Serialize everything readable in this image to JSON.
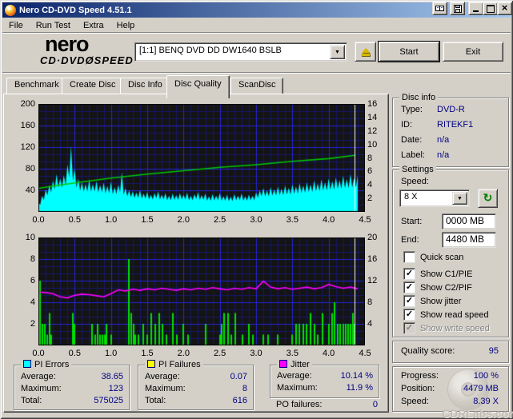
{
  "window": {
    "title": "Nero CD-DVD Speed 4.51.1"
  },
  "titlebar_buttons": {
    "minimize": "_",
    "maximize": "",
    "close": "×"
  },
  "menu": {
    "items": [
      "File",
      "Run Test",
      "Extra",
      "Help"
    ]
  },
  "logo": {
    "line1": "nero",
    "line2": "CD·DVDØSPEED"
  },
  "header": {
    "drive": "[1:1]  BENQ DVD DD DW1640 BSLB",
    "start_label": "Start",
    "exit_label": "Exit"
  },
  "tabs": {
    "items": [
      "Benchmark",
      "Create Disc",
      "Disc Info",
      "Disc Quality",
      "ScanDisc"
    ],
    "active": "Disc Quality"
  },
  "disc_info": {
    "title": "Disc info",
    "rows": [
      {
        "label": "Type:",
        "value": "DVD-R"
      },
      {
        "label": "ID:",
        "value": "RITEKF1"
      },
      {
        "label": "Date:",
        "value": "n/a"
      },
      {
        "label": "Label:",
        "value": "n/a"
      }
    ]
  },
  "settings": {
    "title": "Settings",
    "speed_label": "Speed:",
    "speed_value": "8 X",
    "start_label": "Start:",
    "start_value": "0000 MB",
    "end_label": "End:",
    "end_value": "4480 MB",
    "checkboxes": [
      {
        "label": "Quick scan",
        "checked": false,
        "disabled": false
      },
      {
        "label": "Show C1/PIE",
        "checked": true,
        "disabled": false
      },
      {
        "label": "Show C2/PIF",
        "checked": true,
        "disabled": false
      },
      {
        "label": "Show jitter",
        "checked": true,
        "disabled": false
      },
      {
        "label": "Show read speed",
        "checked": true,
        "disabled": false
      },
      {
        "label": "Show write speed",
        "checked": true,
        "disabled": true
      }
    ]
  },
  "quality": {
    "label": "Quality score:",
    "value": "95"
  },
  "progress": {
    "rows": [
      {
        "label": "Progress:",
        "value": "100 %"
      },
      {
        "label": "Position:",
        "value": "4479 MB"
      },
      {
        "label": "Speed:",
        "value": "8.39 X"
      }
    ]
  },
  "stats": {
    "pi_errors": {
      "title": "PI Errors",
      "color": "#00ffff",
      "rows": [
        {
          "label": "Average:",
          "value": "38.65"
        },
        {
          "label": "Maximum:",
          "value": "123"
        },
        {
          "label": "Total:",
          "value": "575025"
        }
      ]
    },
    "pi_failures": {
      "title": "PI Failures",
      "color": "#ffff00",
      "rows": [
        {
          "label": "Average:",
          "value": "0.07"
        },
        {
          "label": "Maximum:",
          "value": "8"
        },
        {
          "label": "Total:",
          "value": "616"
        }
      ]
    },
    "jitter": {
      "title": "Jitter",
      "color": "#ff00ff",
      "rows": [
        {
          "label": "Average:",
          "value": "10.14 %"
        },
        {
          "label": "Maximum:",
          "value": "11.9 %"
        }
      ]
    },
    "po_failures": {
      "label": "PO failures:",
      "value": "0"
    }
  },
  "watermark": "CDRLabs.com",
  "colors": {
    "pie_area": "#00ffff",
    "read_speed": "#00c800",
    "pif_bars": "#00e000",
    "jitter_line": "#ff00ff",
    "grid_major": "#2525d8",
    "grid_minor": "#17176a",
    "chart_bg": "#141414",
    "position_marker": "#ffffff",
    "value_text": "#000080"
  },
  "chart_data": [
    {
      "type": "area",
      "title": "PI Errors (C1/PIE) with read-speed overlay",
      "x_unit": "GB",
      "x_range": [
        0,
        4.5
      ],
      "x_ticks": [
        "0.0",
        "0.5",
        "1.0",
        "1.5",
        "2.0",
        "2.5",
        "3.0",
        "3.5",
        "4.0",
        "4.5"
      ],
      "left_axis": {
        "range": [
          0,
          200
        ],
        "ticks": [
          200,
          160,
          120,
          80,
          40
        ]
      },
      "right_axis": {
        "range": [
          0,
          16
        ],
        "ticks": [
          16,
          14,
          12,
          10,
          8,
          6,
          4,
          2
        ]
      },
      "position_marker_x": 4.36,
      "series": [
        {
          "name": "PI Errors",
          "render": "area",
          "axis": "left",
          "color": "#00ffff",
          "x_start": 0,
          "x_step": 0.05,
          "values": [
            18,
            30,
            42,
            50,
            58,
            70,
            62,
            68,
            88,
            123,
            80,
            62,
            55,
            52,
            60,
            52,
            57,
            50,
            54,
            48,
            56,
            46,
            50,
            74,
            44,
            40,
            38,
            36,
            40,
            34,
            37,
            32,
            35,
            38,
            32,
            35,
            30,
            34,
            31,
            35,
            32,
            36,
            30,
            33,
            37,
            31,
            34,
            29,
            33,
            30,
            35,
            29,
            32,
            28,
            33,
            30,
            34,
            29,
            32,
            30,
            36,
            40,
            44,
            40,
            46,
            42,
            47,
            43,
            49,
            45,
            51,
            47,
            53,
            49,
            55,
            51,
            58,
            53,
            60,
            55,
            62,
            57,
            64,
            59,
            67,
            61,
            70,
            63,
            68
          ]
        },
        {
          "name": "Read speed",
          "render": "line",
          "axis": "right",
          "color": "#00c800",
          "points": [
            [
              0,
              3.5
            ],
            [
              0.5,
              4.3
            ],
            [
              1.0,
              5.0
            ],
            [
              1.5,
              5.6
            ],
            [
              2.0,
              6.1
            ],
            [
              2.5,
              6.6
            ],
            [
              3.0,
              7.0
            ],
            [
              3.5,
              7.5
            ],
            [
              4.0,
              7.9
            ],
            [
              4.36,
              8.39
            ]
          ]
        }
      ]
    },
    {
      "type": "bar",
      "title": "PI Failures (C2/PIF) with jitter overlay",
      "x_unit": "GB",
      "x_range": [
        0,
        4.5
      ],
      "x_ticks": [
        "0.0",
        "0.5",
        "1.0",
        "1.5",
        "2.0",
        "2.5",
        "3.0",
        "3.5",
        "4.0",
        "4.5"
      ],
      "left_axis": {
        "range": [
          0,
          10
        ],
        "ticks": [
          10,
          8,
          6,
          4,
          2
        ]
      },
      "right_axis": {
        "range": [
          0,
          20
        ],
        "ticks": [
          20,
          16,
          12,
          8,
          4
        ]
      },
      "position_marker_x": 4.36,
      "series": [
        {
          "name": "PI Failures",
          "render": "bars",
          "axis": "left",
          "color": "#00e000",
          "points": [
            [
              0.02,
              6
            ],
            [
              0.05,
              2
            ],
            [
              0.09,
              2
            ],
            [
              0.12,
              1
            ],
            [
              0.15,
              3
            ],
            [
              0.18,
              1
            ],
            [
              0.47,
              3
            ],
            [
              0.5,
              2
            ],
            [
              0.74,
              2
            ],
            [
              0.78,
              1
            ],
            [
              0.82,
              2
            ],
            [
              0.85,
              1
            ],
            [
              0.88,
              1
            ],
            [
              0.91,
              1
            ],
            [
              0.94,
              2
            ],
            [
              1.0,
              1
            ],
            [
              1.25,
              8
            ],
            [
              1.28,
              3
            ],
            [
              1.31,
              2
            ],
            [
              1.34,
              1
            ],
            [
              1.38,
              1
            ],
            [
              1.45,
              2
            ],
            [
              1.5,
              1
            ],
            [
              1.56,
              3
            ],
            [
              1.61,
              2
            ],
            [
              1.66,
              3
            ],
            [
              1.71,
              2
            ],
            [
              1.76,
              1
            ],
            [
              1.85,
              3
            ],
            [
              1.91,
              1
            ],
            [
              2.0,
              2
            ],
            [
              2.06,
              1
            ],
            [
              2.3,
              2
            ],
            [
              2.5,
              1
            ],
            [
              2.53,
              2
            ],
            [
              2.56,
              3
            ],
            [
              2.61,
              3
            ],
            [
              2.66,
              1
            ],
            [
              2.71,
              3
            ],
            [
              2.81,
              1
            ],
            [
              2.9,
              2
            ],
            [
              2.96,
              1
            ],
            [
              3.1,
              1
            ],
            [
              3.16,
              1
            ],
            [
              3.3,
              1
            ],
            [
              3.5,
              1
            ],
            [
              3.55,
              2
            ],
            [
              3.6,
              2
            ],
            [
              3.65,
              2
            ],
            [
              3.7,
              2
            ],
            [
              3.75,
              3
            ],
            [
              3.8,
              2
            ],
            [
              3.85,
              1
            ],
            [
              3.91,
              3
            ],
            [
              4.0,
              2
            ],
            [
              4.05,
              3
            ],
            [
              4.08,
              4
            ],
            [
              4.12,
              2
            ],
            [
              4.16,
              2
            ],
            [
              4.2,
              2
            ],
            [
              4.24,
              2
            ],
            [
              4.27,
              2
            ],
            [
              4.3,
              2
            ],
            [
              4.33,
              3
            ],
            [
              4.36,
              2
            ]
          ]
        },
        {
          "name": "Jitter",
          "render": "line",
          "axis": "right",
          "color": "#ff00ff",
          "x_start": 0,
          "x_step": 0.1,
          "values": [
            9.9,
            9.8,
            9.6,
            9.0,
            8.8,
            9.3,
            9.5,
            9.4,
            9.2,
            9.0,
            9.6,
            10.3,
            10.1,
            10.4,
            10.2,
            10.5,
            10.3,
            10.6,
            10.4,
            10.2,
            10.5,
            10.3,
            10.6,
            10.4,
            10.7,
            10.5,
            10.3,
            10.6,
            10.4,
            10.7,
            10.5,
            11.9,
            10.8,
            10.5,
            10.7,
            10.4,
            10.6,
            10.8,
            10.5,
            10.7,
            11.3,
            10.9,
            10.6,
            10.8,
            10.5
          ]
        }
      ]
    }
  ]
}
